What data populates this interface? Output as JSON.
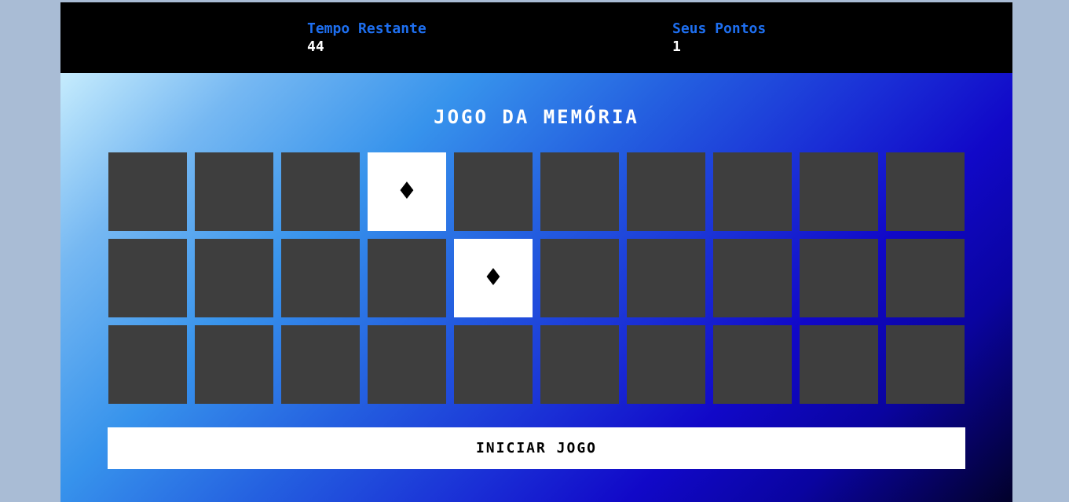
{
  "header": {
    "time_label": "Tempo Restante",
    "time_value": "44",
    "score_label": "Seus Pontos",
    "score_value": "1"
  },
  "game": {
    "title": "JOGO DA MEMÓRIA",
    "grid": {
      "rows": 3,
      "columns": 10
    },
    "revealed_cards": [
      {
        "row": 1,
        "column": 4,
        "symbol": "♦"
      },
      {
        "row": 2,
        "column": 5,
        "symbol": "♦"
      }
    ],
    "start_button_label": "INICIAR JOGO"
  },
  "colors": {
    "card_back": "#3e3e3e",
    "card_face": "#ffffff",
    "stat_label": "#1e6ff0",
    "header_background": "#000000"
  }
}
